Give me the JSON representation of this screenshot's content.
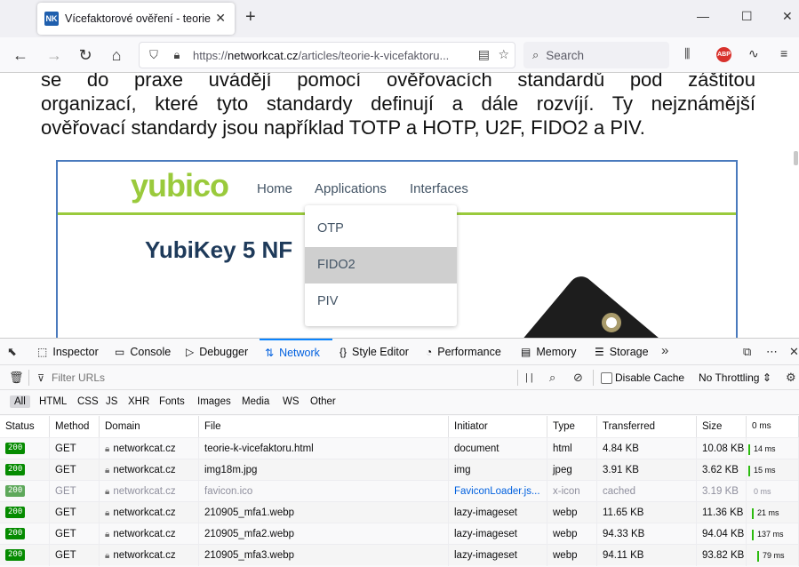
{
  "tab": {
    "favicon": "NK",
    "title": "Vícefaktorové ověření - teorie",
    "close": "✕",
    "new_tab": "+"
  },
  "window": {
    "minimize": "—",
    "maximize": "☐",
    "close": "✕"
  },
  "nav": {
    "url_prefix": "https://",
    "url_domain": "networkcat.cz",
    "url_path": "/articles/teorie-k-vicefaktoru...",
    "search_placeholder": "Search",
    "abp": "ABP"
  },
  "article": {
    "lines": [
      "se do praxe uvádějí pomocí ověřovacích standardů pod záštitou",
      "organizací, které tyto standardy definují a dále rozvíjí. Ty nejznámější",
      "ověřovací standardy jsou například TOTP a HOTP, U2F, FIDO2 a PIV."
    ]
  },
  "figure": {
    "logo": "yubico",
    "nav": [
      "Home",
      "Applications",
      "Interfaces"
    ],
    "heading": "YubiKey 5 NF",
    "dropdown": [
      {
        "label": "OTP",
        "selected": false
      },
      {
        "label": "FIDO2",
        "selected": true
      },
      {
        "label": "PIV",
        "selected": false
      }
    ]
  },
  "devtools": {
    "tabs": [
      {
        "label": "Inspector",
        "icon": "⬚"
      },
      {
        "label": "Console",
        "icon": "▭"
      },
      {
        "label": "Debugger",
        "icon": "▷"
      },
      {
        "label": "Network",
        "icon": "⇅"
      },
      {
        "label": "Style Editor",
        "icon": "{}"
      },
      {
        "label": "Performance",
        "icon": "◔"
      },
      {
        "label": "Memory",
        "icon": "▤"
      },
      {
        "label": "Storage",
        "icon": "☰"
      }
    ],
    "filter_placeholder": "Filter URLs",
    "pause": "| |",
    "disable_cache": "Disable Cache",
    "throttling": "No Throttling ⇕",
    "type_filters": [
      "All",
      "HTML",
      "CSS",
      "JS",
      "XHR",
      "Fonts",
      "Images",
      "Media",
      "WS",
      "Other"
    ],
    "columns": [
      "Status",
      "Method",
      "Domain",
      "File",
      "Initiator",
      "Type",
      "Transferred",
      "Size",
      "0 ms"
    ],
    "requests": [
      {
        "status": "200",
        "method": "GET",
        "domain": "networkcat.cz",
        "file": "teorie-k-vicefaktoru.html",
        "initiator": "document",
        "type": "html",
        "transferred": "4.84 KB",
        "size": "10.08 KB",
        "timing": "14 ms",
        "timing_offset": 0.0,
        "faded": false
      },
      {
        "status": "200",
        "method": "GET",
        "domain": "networkcat.cz",
        "file": "img18m.jpg",
        "initiator": "img",
        "type": "jpeg",
        "transferred": "3.91 KB",
        "size": "3.62 KB",
        "timing": "15 ms",
        "timing_offset": 0.0,
        "faded": false
      },
      {
        "status": "200",
        "method": "GET",
        "domain": "networkcat.cz",
        "file": "favicon.ico",
        "initiator": "FaviconLoader.js...",
        "type": "x-icon",
        "transferred": "cached",
        "size": "3.19 KB",
        "timing": "0 ms",
        "timing_offset": 0.0,
        "faded": true
      },
      {
        "status": "200",
        "method": "GET",
        "domain": "networkcat.cz",
        "file": "210905_mfa1.webp",
        "initiator": "lazy-imageset",
        "type": "webp",
        "transferred": "11.65 KB",
        "size": "11.36 KB",
        "timing": "21 ms",
        "timing_offset": 0.1,
        "faded": false
      },
      {
        "status": "200",
        "method": "GET",
        "domain": "networkcat.cz",
        "file": "210905_mfa2.webp",
        "initiator": "lazy-imageset",
        "type": "webp",
        "transferred": "94.33 KB",
        "size": "94.04 KB",
        "timing": "137 ms",
        "timing_offset": 0.1,
        "faded": false
      },
      {
        "status": "200",
        "method": "GET",
        "domain": "networkcat.cz",
        "file": "210905_mfa3.webp",
        "initiator": "lazy-imageset",
        "type": "webp",
        "transferred": "94.11 KB",
        "size": "93.82 KB",
        "timing": "79 ms",
        "timing_offset": 0.25,
        "faded": false
      }
    ]
  }
}
